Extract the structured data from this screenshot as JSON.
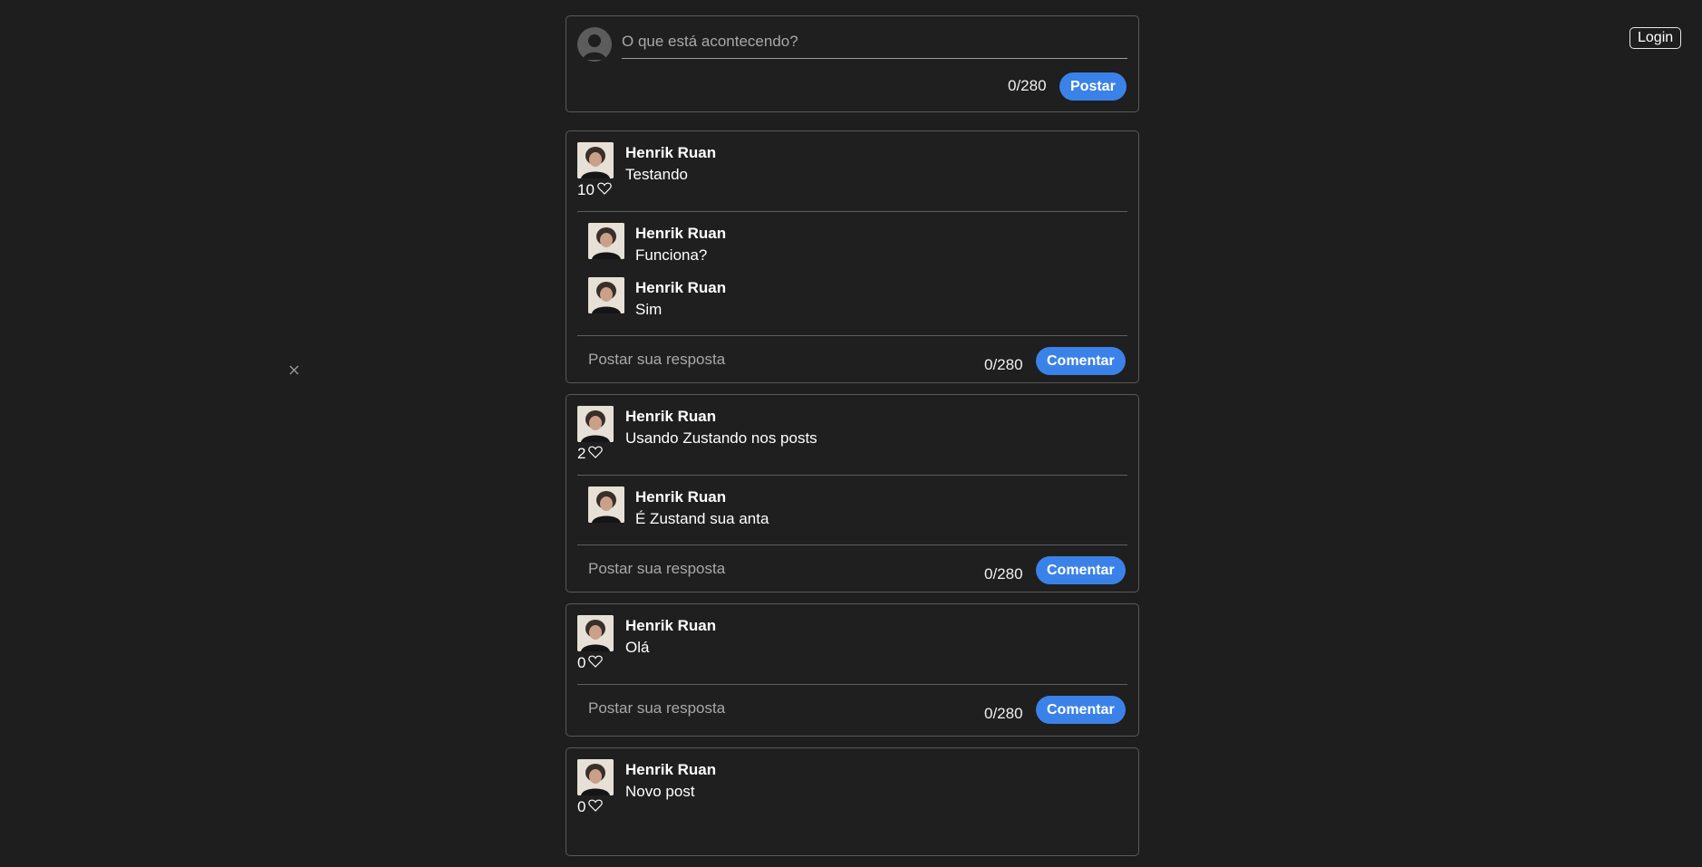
{
  "header": {
    "login_label": "Login"
  },
  "composer": {
    "placeholder": "O que está acontecendo?",
    "counter": "0/280",
    "post_label": "Postar"
  },
  "posts": [
    {
      "author": "Henrik Ruan",
      "text": "Testando",
      "likes": "10",
      "comments": [
        {
          "author": "Henrik Ruan",
          "text": "Funciona?"
        },
        {
          "author": "Henrik Ruan",
          "text": "Sim"
        }
      ],
      "reply_placeholder": "Postar sua resposta",
      "reply_counter": "0/280",
      "comment_label": "Comentar"
    },
    {
      "author": "Henrik Ruan",
      "text": "Usando Zustando nos posts",
      "likes": "2",
      "comments": [
        {
          "author": "Henrik Ruan",
          "text": "É Zustand sua anta"
        }
      ],
      "reply_placeholder": "Postar sua resposta",
      "reply_counter": "0/280",
      "comment_label": "Comentar"
    },
    {
      "author": "Henrik Ruan",
      "text": "Olá",
      "likes": "0",
      "comments": [],
      "reply_placeholder": "Postar sua resposta",
      "reply_counter": "0/280",
      "comment_label": "Comentar"
    },
    {
      "author": "Henrik Ruan",
      "text": "Novo post",
      "likes": "0",
      "comments": [],
      "reply_placeholder": "",
      "reply_counter": "",
      "comment_label": ""
    }
  ],
  "colors": {
    "background": "#1e1e1e",
    "accent": "#3b82e8",
    "border": "#5a5a5a"
  },
  "icons": [
    "user-icon",
    "heart-icon",
    "close-icon"
  ]
}
